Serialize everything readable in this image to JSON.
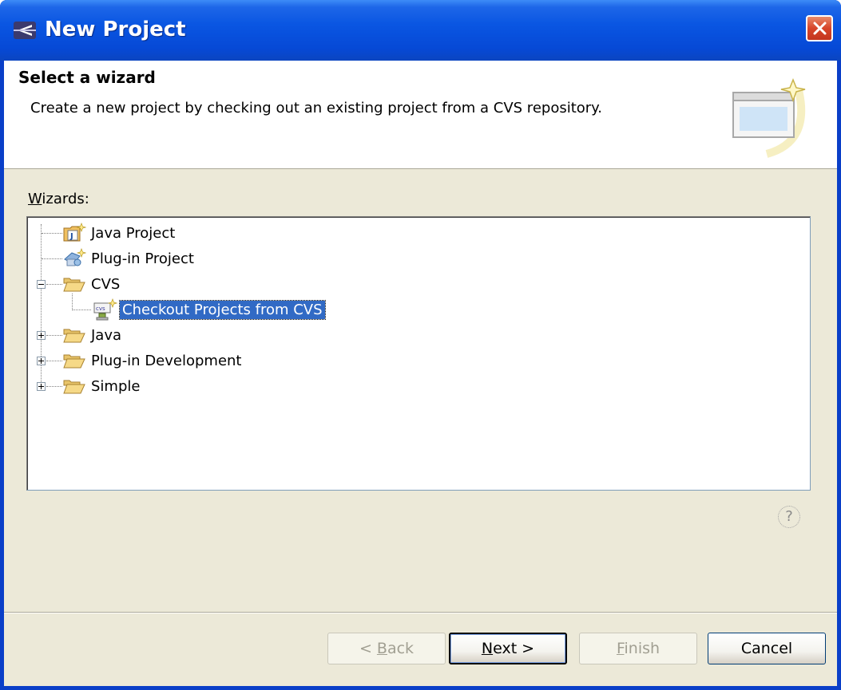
{
  "window": {
    "title": "New Project"
  },
  "banner": {
    "title": "Select a wizard",
    "description": "Create a new project by checking out an existing project from a CVS repository."
  },
  "wizards": {
    "label_prefix": "W",
    "label_rest": "izards:",
    "items": [
      {
        "label": "Java Project",
        "icon": "java-project-icon"
      },
      {
        "label": "Plug-in Project",
        "icon": "plugin-project-icon"
      },
      {
        "label": "CVS",
        "icon": "folder-open-icon",
        "expanded": true
      },
      {
        "label": "Checkout Projects from CVS",
        "icon": "cvs-checkout-icon",
        "selected": true
      },
      {
        "label": "Java",
        "icon": "folder-open-icon",
        "expanded": false
      },
      {
        "label": "Plug-in Development",
        "icon": "folder-open-icon",
        "expanded": false
      },
      {
        "label": "Simple",
        "icon": "folder-open-icon",
        "expanded": false
      }
    ]
  },
  "buttons": {
    "back_prefix": "< ",
    "back_mnemonic": "B",
    "back_rest": "ack",
    "next_mnemonic": "N",
    "next_rest": "ext >",
    "finish_mnemonic": "F",
    "finish_rest": "inish",
    "cancel": "Cancel"
  },
  "help": {
    "glyph": "?"
  },
  "colors": {
    "selection": "#316ac5",
    "titlebar": "#0a56e2",
    "dialog_bg": "#ece9d8"
  }
}
